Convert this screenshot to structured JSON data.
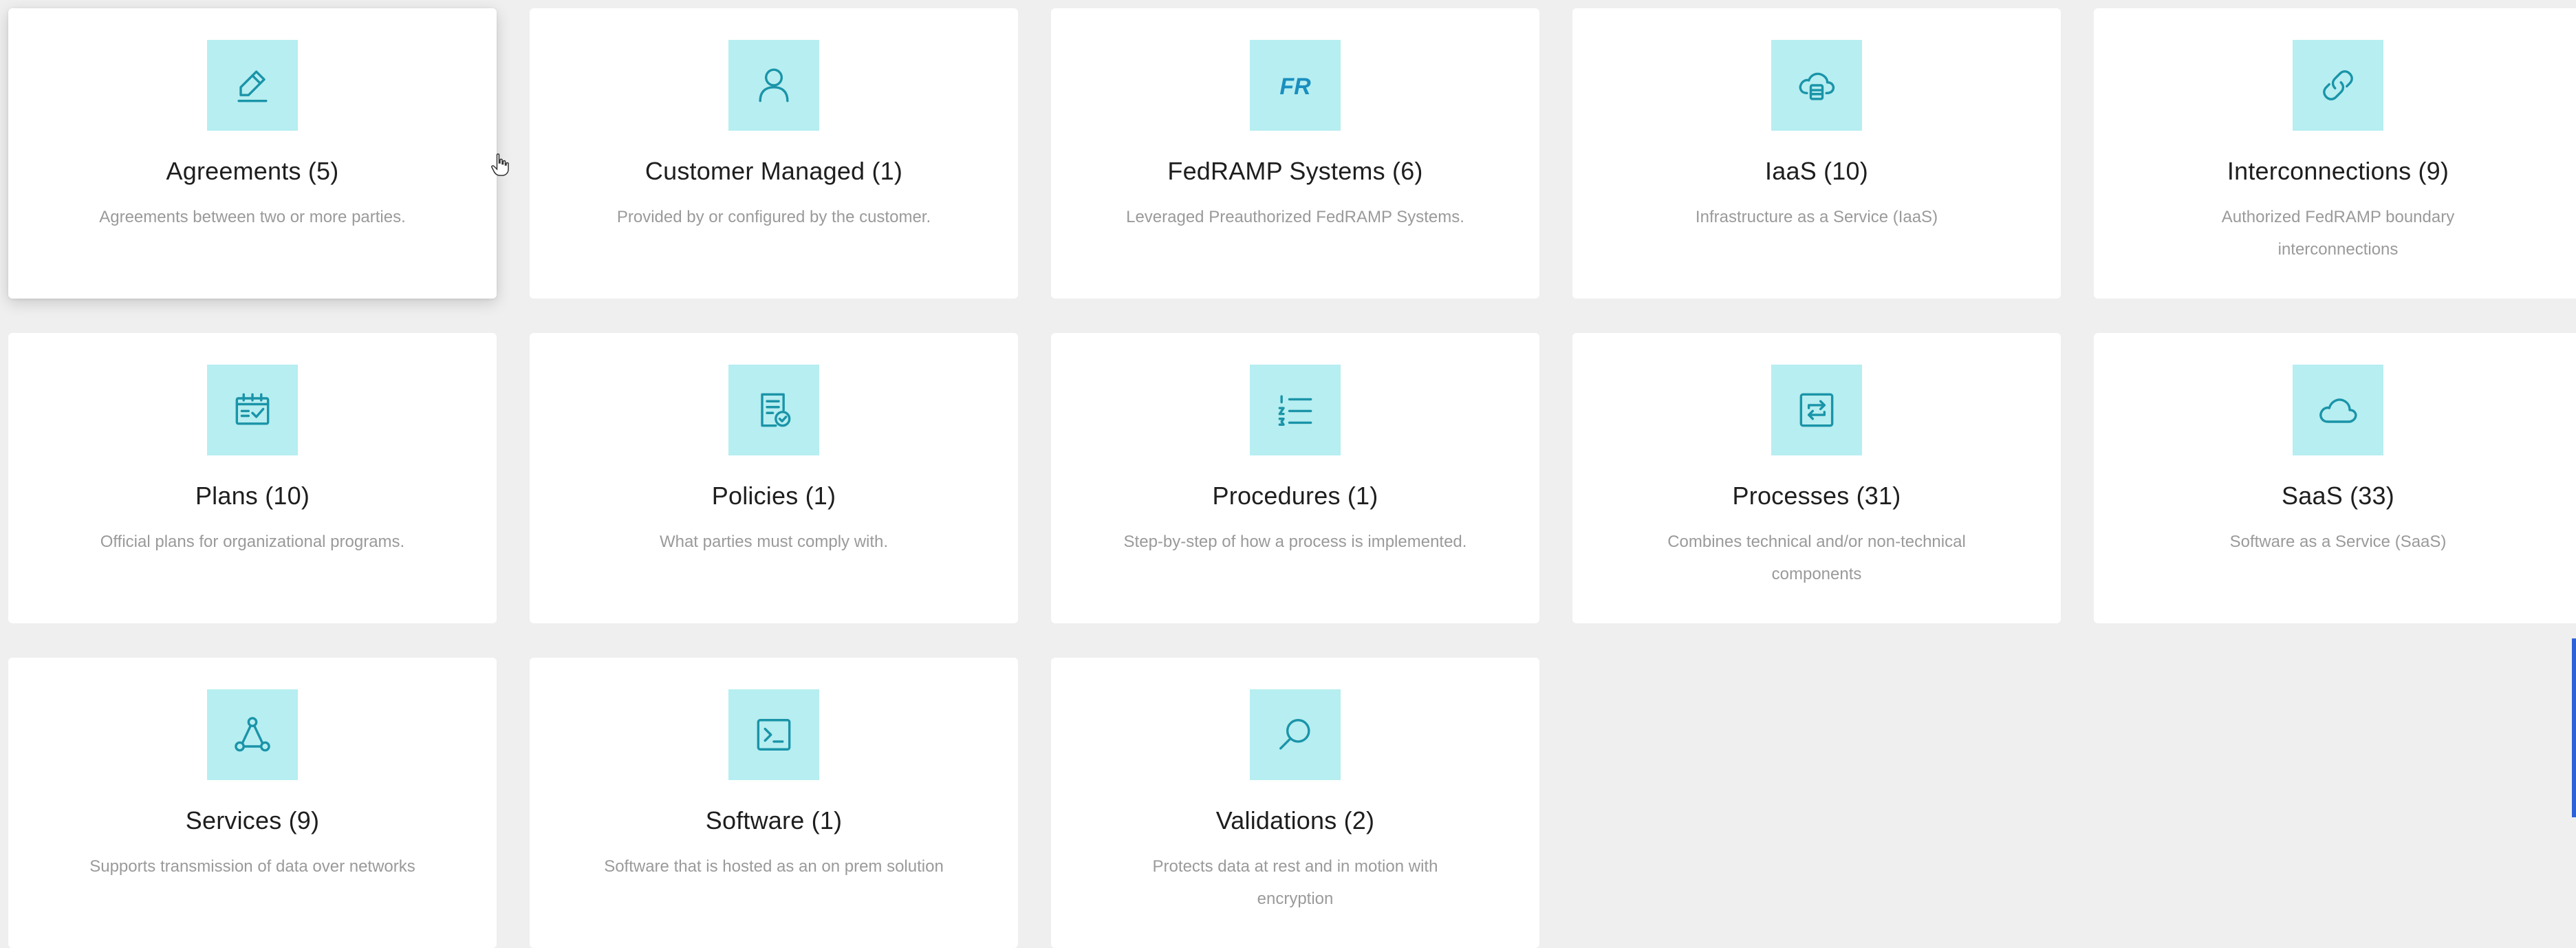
{
  "colors": {
    "page_bg": "#efefef",
    "card_bg": "#ffffff",
    "icon_tile": "#b7eef1",
    "icon_stroke": "#1a94a8",
    "title_text": "#1e1e1e",
    "desc_text": "#9a9a9a"
  },
  "cards": [
    {
      "icon": "pencil-icon",
      "title": "Agreements (5)",
      "description": "Agreements between two or more parties.",
      "highlighted": true
    },
    {
      "icon": "person-icon",
      "title": "Customer Managed (1)",
      "description": "Provided by or configured by the customer."
    },
    {
      "icon": "fedramp-fr-icon",
      "icon_text": "FR",
      "title": "FedRAMP Systems (6)",
      "description": "Leveraged Preauthorized FedRAMP Systems."
    },
    {
      "icon": "cloud-server-icon",
      "title": "IaaS (10)",
      "description": "Infrastructure as a Service (IaaS)"
    },
    {
      "icon": "link-icon",
      "title": "Interconnections (9)",
      "description": "Authorized FedRAMP boundary interconnections"
    },
    {
      "icon": "calendar-check-icon",
      "title": "Plans (10)",
      "description": "Official plans for organizational programs."
    },
    {
      "icon": "document-check-icon",
      "title": "Policies (1)",
      "description": "What parties must comply with."
    },
    {
      "icon": "numbered-list-icon",
      "title": "Procedures (1)",
      "description": "Step-by-step of how a process is implemented."
    },
    {
      "icon": "process-loop-icon",
      "title": "Processes (31)",
      "description": "Combines technical and/or non-technical components"
    },
    {
      "icon": "cloud-icon",
      "title": "SaaS (33)",
      "description": "Software as a Service (SaaS)"
    },
    {
      "icon": "network-nodes-icon",
      "title": "Services (9)",
      "description": "Supports transmission of data over networks"
    },
    {
      "icon": "terminal-icon",
      "title": "Software (1)",
      "description": "Software that is hosted as an on prem solution"
    },
    {
      "icon": "magnifier-icon",
      "title": "Validations (2)",
      "description": "Protects data at rest and in motion with encryption"
    }
  ]
}
